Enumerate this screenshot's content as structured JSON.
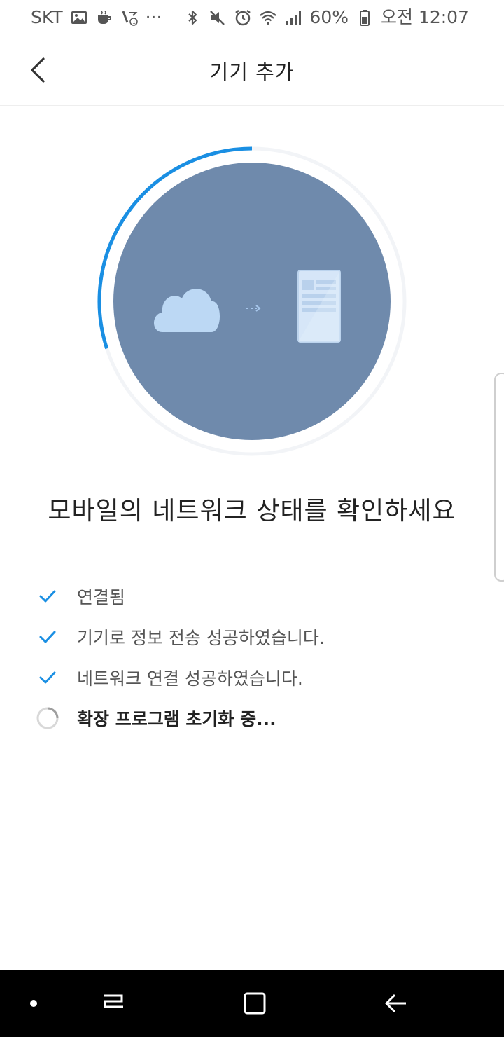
{
  "status_bar": {
    "carrier": "SKT",
    "more": "···",
    "battery_percent": "60%",
    "time": "오전 12:07",
    "icons_left": [
      "gallery-icon",
      "coffee-icon",
      "call-forward-icon"
    ],
    "icons_right": [
      "bluetooth-icon",
      "mute-icon",
      "alarm-icon",
      "wifi-icon",
      "signal-icon",
      "battery-icon"
    ]
  },
  "header": {
    "title": "기기 추가"
  },
  "illustration": {
    "icons": [
      "cloud-icon",
      "dashed-arrow-icon",
      "device-icon"
    ],
    "progress": 0.3
  },
  "main": {
    "message": "모바일의 네트워크 상태를 확인하세요"
  },
  "steps": [
    {
      "label": "연결됨",
      "status": "done"
    },
    {
      "label": "기기로 정보 전송 성공하였습니다.",
      "status": "done"
    },
    {
      "label": "네트워크 연결 성공하였습니다.",
      "status": "done"
    },
    {
      "label": "확장 프로그램 초기화 중...",
      "status": "loading"
    }
  ],
  "colors": {
    "accent": "#1a8fe3",
    "circle": "#6f8aac",
    "cloud": "#bcd8f4",
    "device": "#d6e6f8",
    "nav_bar": "#000000"
  },
  "nav_bar": {
    "items": [
      "dot-icon",
      "recents-icon",
      "home-icon",
      "back-arrow-icon"
    ]
  }
}
